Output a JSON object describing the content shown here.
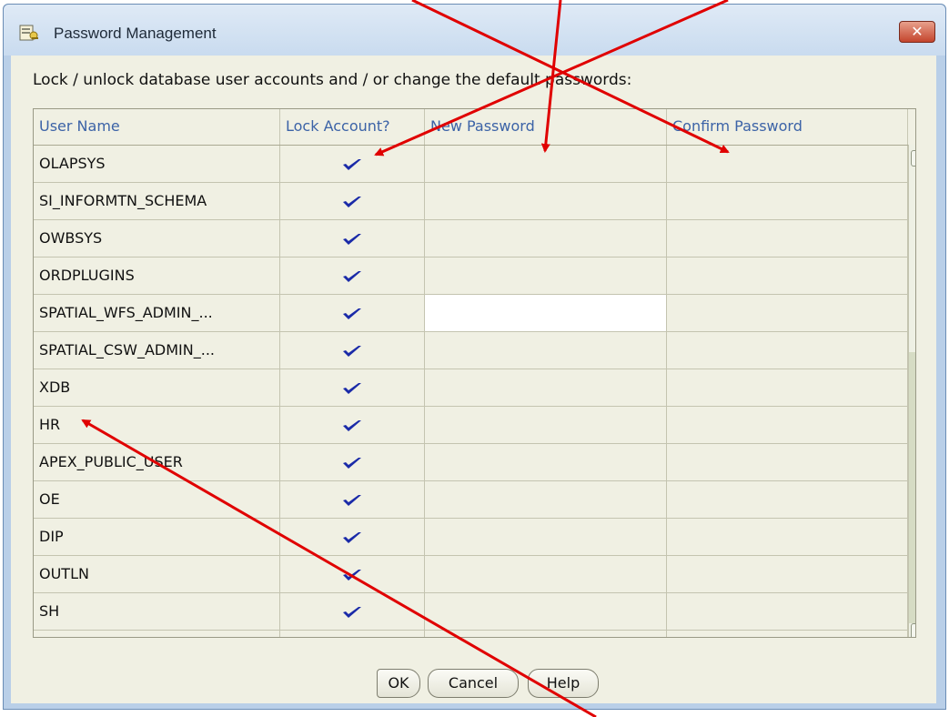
{
  "window": {
    "title": "Password Management",
    "close_glyph": "✕",
    "icon": "database-key-icon"
  },
  "instruction": "Lock / unlock database user accounts and / or change the default passwords:",
  "table": {
    "columns": [
      "User Name",
      "Lock Account?",
      "New Password",
      "Confirm Password"
    ],
    "rows": [
      {
        "user": "OLAPSYS",
        "locked": true
      },
      {
        "user": "SI_INFORMTN_SCHEMA",
        "locked": true
      },
      {
        "user": "OWBSYS",
        "locked": true
      },
      {
        "user": "ORDPLUGINS",
        "locked": true
      },
      {
        "user": "SPATIAL_WFS_ADMIN_...",
        "locked": true
      },
      {
        "user": "SPATIAL_CSW_ADMIN_...",
        "locked": true
      },
      {
        "user": "XDB",
        "locked": true
      },
      {
        "user": "HR",
        "locked": true
      },
      {
        "user": "APEX_PUBLIC_USER",
        "locked": true
      },
      {
        "user": "OE",
        "locked": true
      },
      {
        "user": "DIP",
        "locked": true
      },
      {
        "user": "OUTLN",
        "locked": true
      },
      {
        "user": "SH",
        "locked": true
      }
    ],
    "active_row_index": 4,
    "check_color": "#1a2aa8"
  },
  "buttons": {
    "ok": "OK",
    "cancel": "Cancel",
    "help": "Help"
  },
  "annotation_color": "#e00000"
}
